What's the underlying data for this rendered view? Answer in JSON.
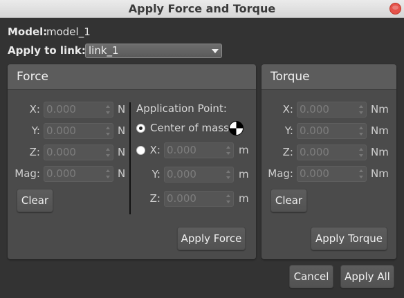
{
  "window": {
    "title": "Apply Force and Torque"
  },
  "model": {
    "label": "Model:",
    "value": "model_1"
  },
  "link": {
    "label": "Apply to link:",
    "selected": "link_1"
  },
  "force": {
    "title": "Force",
    "fields": [
      {
        "label": "X:",
        "value": "0.000",
        "unit": "N"
      },
      {
        "label": "Y:",
        "value": "0.000",
        "unit": "N"
      },
      {
        "label": "Z:",
        "value": "0.000",
        "unit": "N"
      },
      {
        "label": "Mag:",
        "value": "0.000",
        "unit": "N"
      }
    ],
    "clear_label": "Clear",
    "apply_label": "Apply Force",
    "application_point": {
      "title": "Application Point:",
      "center_of_mass_label": "Center of mass",
      "center_of_mass_selected": true,
      "fields": [
        {
          "label": "X:",
          "value": "0.000",
          "unit": "m"
        },
        {
          "label": "Y:",
          "value": "0.000",
          "unit": "m"
        },
        {
          "label": "Z:",
          "value": "0.000",
          "unit": "m"
        }
      ]
    }
  },
  "torque": {
    "title": "Torque",
    "fields": [
      {
        "label": "X:",
        "value": "0.000",
        "unit": "Nm"
      },
      {
        "label": "Y:",
        "value": "0.000",
        "unit": "Nm"
      },
      {
        "label": "Z:",
        "value": "0.000",
        "unit": "Nm"
      },
      {
        "label": "Mag:",
        "value": "0.000",
        "unit": "Nm"
      }
    ],
    "clear_label": "Clear",
    "apply_label": "Apply Torque"
  },
  "footer": {
    "cancel_label": "Cancel",
    "apply_all_label": "Apply All"
  },
  "colors": {
    "background": "#333333",
    "panel": "#4b4b4b",
    "panel_header": "#5c5c5c",
    "close": "#e5534b"
  },
  "icons": {
    "close": "close-icon",
    "center_of_mass": "center-of-mass-icon"
  }
}
